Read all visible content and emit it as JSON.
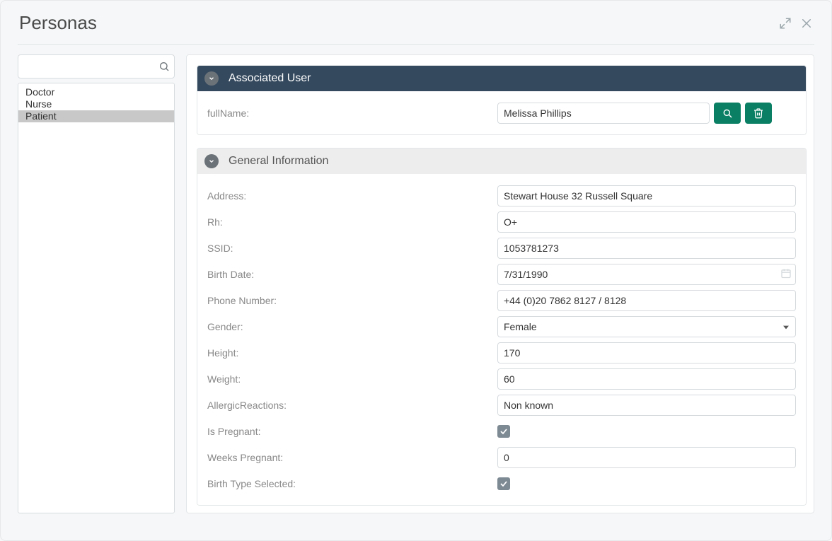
{
  "title": "Personas",
  "search": {
    "value": ""
  },
  "sidebar": {
    "items": [
      {
        "label": "Doctor",
        "selected": false
      },
      {
        "label": "Nurse",
        "selected": false
      },
      {
        "label": "Patient",
        "selected": true
      }
    ]
  },
  "sections": {
    "associated_user": {
      "title": "Associated User",
      "fields": {
        "fullName": {
          "label": "fullName:",
          "value": "Melissa Phillips"
        }
      }
    },
    "general_information": {
      "title": "General Information",
      "fields": {
        "address": {
          "label": "Address:",
          "value": "Stewart House 32 Russell Square"
        },
        "rh": {
          "label": "Rh:",
          "value": "O+"
        },
        "ssid": {
          "label": "SSID:",
          "value": "1053781273"
        },
        "birth_date": {
          "label": "Birth Date:",
          "value": "7/31/1990"
        },
        "phone_number": {
          "label": "Phone Number:",
          "value": "+44 (0)20 7862 8127 / 8128"
        },
        "gender": {
          "label": "Gender:",
          "value": "Female"
        },
        "height": {
          "label": "Height:",
          "value": "170"
        },
        "weight": {
          "label": "Weight:",
          "value": "60"
        },
        "allergic_reactions": {
          "label": "AllergicReactions:",
          "value": "Non known"
        },
        "is_pregnant": {
          "label": "Is Pregnant:",
          "checked": true
        },
        "weeks_pregnant": {
          "label": "Weeks Pregnant:",
          "value": "0"
        },
        "birth_type_selected": {
          "label": "Birth Type Selected:",
          "checked": true
        }
      }
    }
  },
  "colors": {
    "accent": "#0a7f63",
    "dark_header": "#34495e"
  }
}
